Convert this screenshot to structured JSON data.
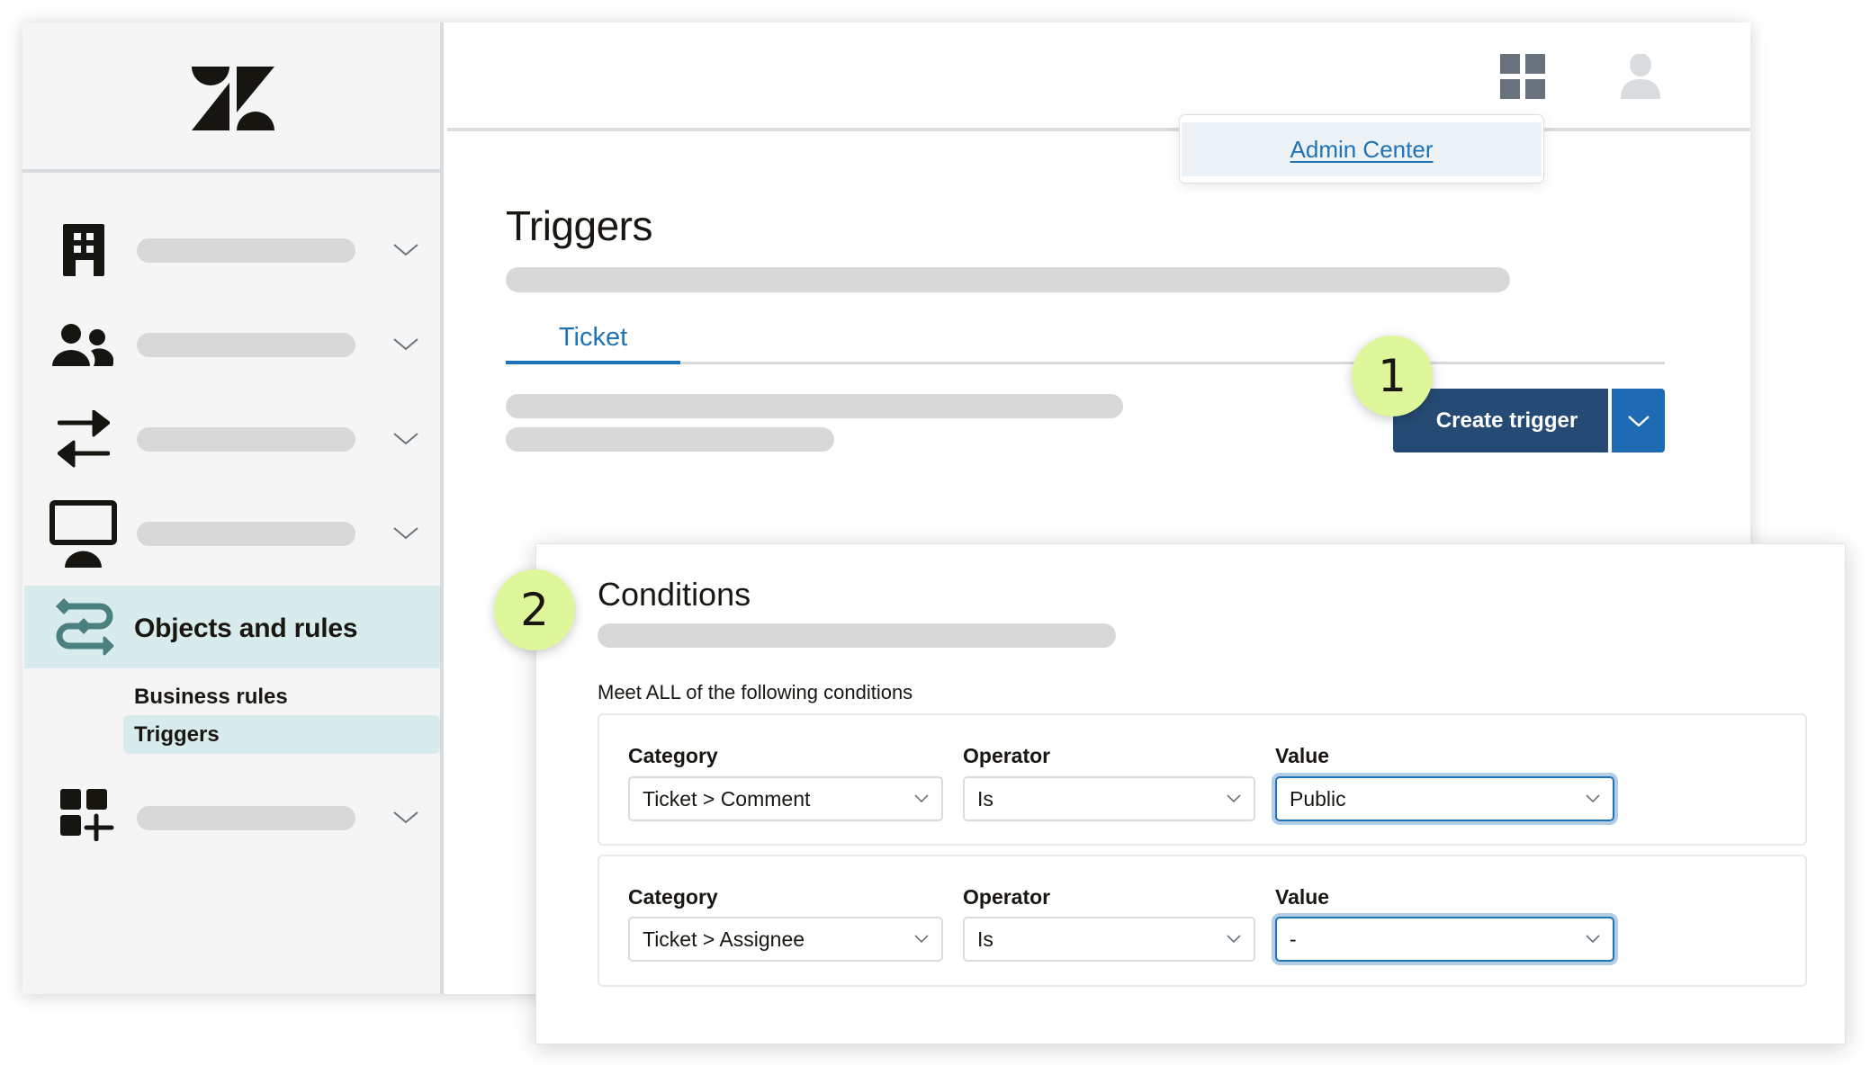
{
  "sidebar": {
    "nav_items": [
      {
        "icon": "building-icon",
        "label_placeholder": true
      },
      {
        "icon": "users-icon",
        "label_placeholder": true
      },
      {
        "icon": "arrows-swap-icon",
        "label_placeholder": true
      },
      {
        "icon": "monitor-icon",
        "label_placeholder": true
      },
      {
        "icon": "objects-rules-icon",
        "label": "Objects and rules",
        "active": true
      },
      {
        "icon": "apps-add-icon",
        "label_placeholder": true
      }
    ],
    "active_section": {
      "label": "Objects and rules",
      "sub_items": [
        {
          "label": "Business rules",
          "type": "heading"
        },
        {
          "label": "Triggers",
          "selected": true
        }
      ]
    }
  },
  "header": {
    "products_icon": "apps-grid-icon",
    "profile_icon": "avatar-icon",
    "popup": {
      "link_label": "Admin Center"
    }
  },
  "page": {
    "title": "Triggers",
    "tabs": [
      {
        "label": "Ticket",
        "active": true
      }
    ],
    "create_button": {
      "label": "Create trigger"
    }
  },
  "callouts": {
    "one": "1",
    "two": "2"
  },
  "conditions": {
    "title": "Conditions",
    "hint": "Meet ALL of the following conditions",
    "rows": [
      {
        "category_label": "Category",
        "category": "Ticket > Comment",
        "operator_label": "Operator",
        "operator": "Is",
        "value_label": "Value",
        "value": "Public"
      },
      {
        "category_label": "Category",
        "category": "Ticket > Assignee",
        "operator_label": "Operator",
        "operator": "Is",
        "value_label": "Value",
        "value": "-"
      }
    ]
  },
  "colors": {
    "brand_dark": "#254b74",
    "brand_blue": "#1f73b7",
    "callout": "#def79a",
    "active_nav": "#d9eced",
    "teal_icon": "#4b8080"
  }
}
